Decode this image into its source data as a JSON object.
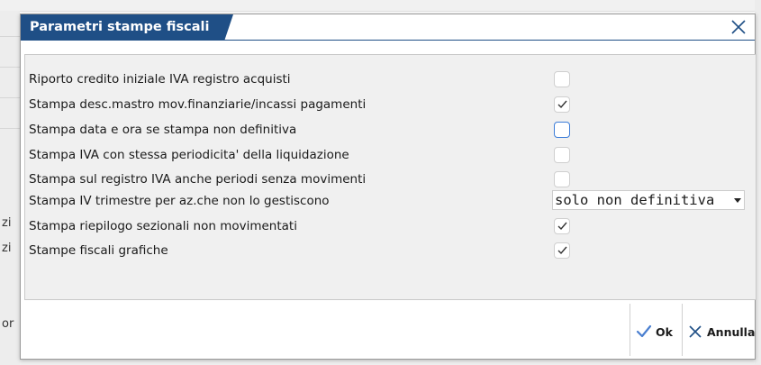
{
  "background": {
    "fragments": [
      "zi",
      "zi",
      "or"
    ]
  },
  "dialog": {
    "title": "Parametri stampe fiscali",
    "close_icon": "close-icon",
    "options": [
      {
        "label": "Riporto credito iniziale IVA registro acquisti",
        "control": "checkbox",
        "checked": false
      },
      {
        "label": "Stampa desc.mastro mov.finanziarie/incassi pagamenti",
        "control": "checkbox",
        "checked": true
      },
      {
        "label": "Stampa data e ora se stampa non definitiva",
        "control": "checkbox",
        "checked": false,
        "focused": true
      },
      {
        "label": "Stampa IVA con stessa periodicita' della liquidazione",
        "control": "checkbox",
        "checked": false
      },
      {
        "label": "Stampa sul registro IVA anche periodi senza movimenti",
        "control": "checkbox",
        "checked": false
      },
      {
        "label": "Stampa IV trimestre per az.che non lo gestiscono",
        "control": "select",
        "value": "solo non definitiva"
      },
      {
        "label": "Stampa riepilogo sezionali non movimentati",
        "control": "checkbox",
        "checked": true
      },
      {
        "label": "Stampe fiscali grafiche",
        "control": "checkbox",
        "checked": true
      }
    ],
    "buttons": {
      "ok_label": "Ok",
      "cancel_label": "Annulla"
    },
    "colors": {
      "title_bg": "#1f4f86",
      "focus_border": "#3d7dd8",
      "ok_icon": "#4a7fd0"
    }
  }
}
